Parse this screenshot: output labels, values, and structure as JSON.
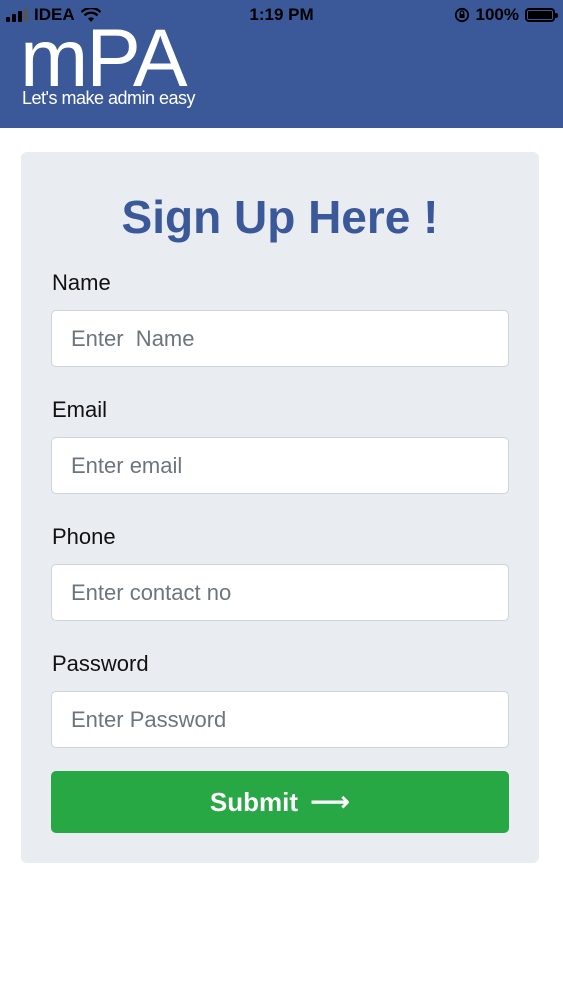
{
  "status_bar": {
    "carrier": "IDEA",
    "time": "1:19 PM",
    "battery": "100%",
    "battery_level": 1.0
  },
  "header": {
    "logo": "mPA",
    "tagline": "Let's make admin easy",
    "background_color": "#3b5998"
  },
  "form": {
    "title": "Sign Up Here !",
    "fields": [
      {
        "label": "Name",
        "placeholder": "Enter  Name",
        "value": ""
      },
      {
        "label": "Email",
        "placeholder": "Enter email",
        "value": ""
      },
      {
        "label": "Phone",
        "placeholder": "Enter contact no",
        "value": ""
      },
      {
        "label": "Password",
        "placeholder": "Enter Password",
        "value": ""
      }
    ],
    "submit_label": "Submit",
    "submit_icon": "arrow-right-icon",
    "submit_color": "#28a745"
  }
}
